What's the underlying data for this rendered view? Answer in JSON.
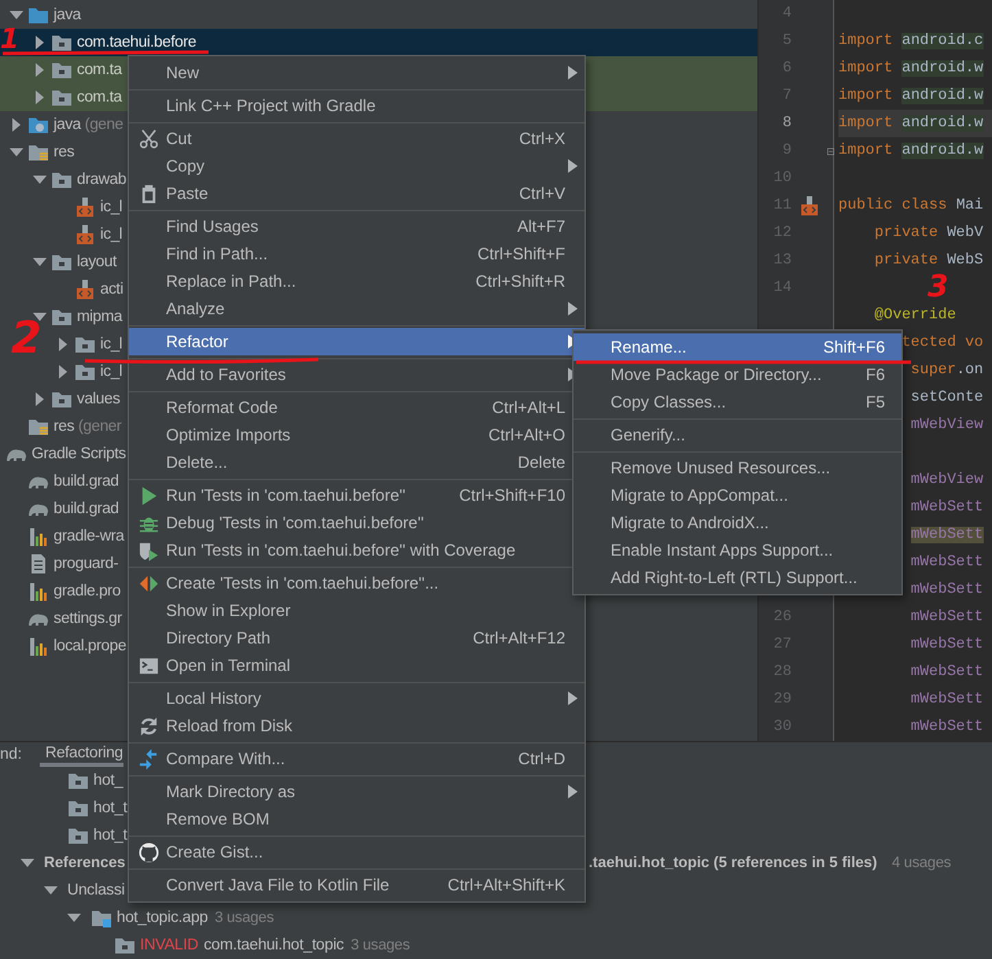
{
  "project_tree": [
    {
      "label": "java",
      "kind": "source-folder",
      "expanded": true,
      "selected": false,
      "highlighted": false,
      "children": [
        {
          "label": "com.taehui.before",
          "kind": "package",
          "expanded": false,
          "selected": true,
          "highlighted": false
        },
        {
          "label": "com.ta",
          "kind": "package",
          "expanded": false,
          "selected": false,
          "highlighted": true
        },
        {
          "label": "com.ta",
          "kind": "package",
          "expanded": false,
          "selected": false,
          "highlighted": true
        }
      ]
    },
    {
      "label": "java",
      "note": " (gene",
      "kind": "generated-folder",
      "expanded": false,
      "selected": false,
      "highlighted": false
    },
    {
      "label": "res",
      "kind": "resource-folder",
      "expanded": true,
      "selected": false,
      "highlighted": false,
      "children": [
        {
          "label": "drawab",
          "kind": "package",
          "expanded": true,
          "selected": false,
          "highlighted": false,
          "children": [
            {
              "label": "ic_l",
              "kind": "xml",
              "selected": false,
              "highlighted": false
            },
            {
              "label": "ic_l",
              "kind": "xml",
              "selected": false,
              "highlighted": false
            }
          ]
        },
        {
          "label": "layout",
          "kind": "package",
          "expanded": true,
          "selected": false,
          "highlighted": false,
          "children": [
            {
              "label": "acti",
              "kind": "xml",
              "selected": false,
              "highlighted": false
            }
          ]
        },
        {
          "label": "mipma",
          "kind": "package",
          "expanded": true,
          "selected": false,
          "highlighted": false,
          "children": [
            {
              "label": "ic_l",
              "kind": "package",
              "expanded": false,
              "selected": false,
              "highlighted": false
            },
            {
              "label": "ic_l",
              "kind": "package",
              "expanded": false,
              "selected": false,
              "highlighted": false
            }
          ]
        },
        {
          "label": "values",
          "kind": "package",
          "expanded": false,
          "selected": false,
          "highlighted": false
        }
      ]
    },
    {
      "label": "res",
      "note": " (gener",
      "kind": "resource-folder",
      "selected": false,
      "highlighted": false
    },
    {
      "label": "Gradle Scripts",
      "kind": "gradle-group",
      "selected": false,
      "highlighted": false,
      "children": [
        {
          "label": "build.grad",
          "kind": "gradle",
          "selected": false,
          "highlighted": false
        },
        {
          "label": "build.grad",
          "kind": "gradle",
          "selected": false,
          "highlighted": false
        },
        {
          "label": "gradle-wra",
          "kind": "properties",
          "selected": false,
          "highlighted": false
        },
        {
          "label": "proguard-",
          "kind": "text",
          "selected": false,
          "highlighted": false
        },
        {
          "label": "gradle.pro",
          "kind": "properties",
          "selected": false,
          "highlighted": false
        },
        {
          "label": "settings.gr",
          "kind": "gradle",
          "selected": false,
          "highlighted": false
        },
        {
          "label": "local.prope",
          "kind": "properties",
          "selected": false,
          "highlighted": false
        }
      ]
    }
  ],
  "editor": {
    "lines": [
      {
        "number": "4",
        "current": false
      },
      {
        "number": "5",
        "current": false,
        "tokens": [
          {
            "text": "import ",
            "kind": "keyword"
          },
          {
            "text": "android.c",
            "kind": "import-path"
          }
        ]
      },
      {
        "number": "6",
        "current": false,
        "tokens": [
          {
            "text": "import ",
            "kind": "keyword"
          },
          {
            "text": "android.w",
            "kind": "import-path"
          }
        ]
      },
      {
        "number": "7",
        "current": false,
        "tokens": [
          {
            "text": "import ",
            "kind": "keyword"
          },
          {
            "text": "android.w",
            "kind": "import-path"
          }
        ]
      },
      {
        "number": "8",
        "current": true,
        "tokens": [
          {
            "text": "import ",
            "kind": "keyword"
          },
          {
            "text": "android.w",
            "kind": "import-path"
          }
        ]
      },
      {
        "number": "9",
        "current": false,
        "kind": "fold",
        "tokens": [
          {
            "text": "import ",
            "kind": "keyword"
          },
          {
            "text": "android.w",
            "kind": "import-path"
          }
        ]
      },
      {
        "number": "10",
        "current": false
      },
      {
        "number": "11",
        "current": false,
        "kind": "layout-file",
        "tokens": [
          {
            "text": "public class ",
            "kind": "keyword"
          },
          {
            "text": "Mai",
            "kind": "plain"
          }
        ]
      },
      {
        "number": "12",
        "current": false,
        "tokens": [
          {
            "text": "    private ",
            "kind": "keyword"
          },
          {
            "text": "WebV",
            "kind": "plain"
          }
        ]
      },
      {
        "number": "13",
        "current": false,
        "tokens": [
          {
            "text": "    private ",
            "kind": "keyword"
          },
          {
            "text": "WebS",
            "kind": "plain"
          }
        ]
      },
      {
        "number": "14",
        "current": false
      },
      {
        "current": false,
        "tokens": [
          {
            "text": "    @Override",
            "kind": "annotation"
          }
        ]
      },
      {
        "current": false,
        "tokens": [
          {
            "text": "       tected vo",
            "kind": "keyword"
          }
        ]
      },
      {
        "current": false,
        "tokens": [
          {
            "text": "        super",
            "kind": "keyword"
          },
          {
            "text": ".on",
            "kind": "plain"
          }
        ]
      },
      {
        "current": false,
        "tokens": [
          {
            "text": "        setConte",
            "kind": "plain"
          }
        ]
      },
      {
        "current": false,
        "tokens": [
          {
            "text": "        mWebView",
            "kind": "field"
          }
        ]
      },
      {
        "current": false
      },
      {
        "current": false,
        "tokens": [
          {
            "text": "        mWebView",
            "kind": "field"
          }
        ]
      },
      {
        "current": false,
        "tokens": [
          {
            "text": "        mWebSett",
            "kind": "field"
          }
        ]
      },
      {
        "current": false,
        "tokens": [
          {
            "text": "        mWebSett",
            "kind": "field-usage"
          }
        ]
      },
      {
        "current": false,
        "tokens": [
          {
            "text": "        mWebSett",
            "kind": "field"
          }
        ]
      },
      {
        "current": false,
        "tokens": [
          {
            "text": "        mWebSett",
            "kind": "field"
          }
        ]
      },
      {
        "number": "26",
        "current": false,
        "tokens": [
          {
            "text": "        mWebSett",
            "kind": "field"
          }
        ]
      },
      {
        "number": "27",
        "current": false,
        "tokens": [
          {
            "text": "        mWebSett",
            "kind": "field"
          }
        ]
      },
      {
        "number": "28",
        "current": false,
        "tokens": [
          {
            "text": "        mWebSett",
            "kind": "field"
          }
        ]
      },
      {
        "number": "29",
        "current": false,
        "tokens": [
          {
            "text": "        mWebSett",
            "kind": "field"
          }
        ]
      },
      {
        "number": "30",
        "current": false,
        "tokens": [
          {
            "text": "        mWebSett",
            "kind": "field"
          }
        ]
      }
    ]
  },
  "find_panel": {
    "label": "nd:",
    "tabs": [
      {
        "label": "Refactoring",
        "selected": true
      }
    ],
    "upper_rows": [
      {
        "label": "hot_",
        "kind": "package"
      },
      {
        "label": "hot_t",
        "kind": "package"
      },
      {
        "label": "hot_t",
        "kind": "package"
      }
    ],
    "results": [
      {
        "label": "References",
        "detail": ".taehui.hot_topic (5 references in 5 files)",
        "count": "4 usages",
        "expanded": true,
        "children": [
          {
            "label": "Unclassi",
            "expanded": true,
            "children": [
              {
                "label": "hot_topic.app",
                "kind": "module",
                "count": "3 usages",
                "expanded": true,
                "children": [
                  {
                    "status": "INVALID",
                    "label": "com.taehui.hot_topic",
                    "kind": "package",
                    "count": "3 usages"
                  }
                ]
              }
            ]
          }
        ]
      }
    ]
  },
  "menu": {
    "sections": [
      [
        {
          "label": "New",
          "has_submenu": true,
          "selected": false
        }
      ],
      [
        {
          "label": "Link C++ Project with Gradle",
          "has_submenu": false,
          "selected": false
        }
      ],
      [
        {
          "label": "Cut",
          "kind": "scissors",
          "shortcut": "Ctrl+X",
          "has_submenu": false,
          "selected": false
        },
        {
          "label": "Copy",
          "has_submenu": true,
          "selected": false
        },
        {
          "label": "Paste",
          "kind": "clipboard",
          "shortcut": "Ctrl+V",
          "has_submenu": false,
          "selected": false
        }
      ],
      [
        {
          "label": "Find Usages",
          "shortcut": "Alt+F7",
          "has_submenu": false,
          "selected": false
        },
        {
          "label": "Find in Path...",
          "shortcut": "Ctrl+Shift+F",
          "has_submenu": false,
          "selected": false
        },
        {
          "label": "Replace in Path...",
          "shortcut": "Ctrl+Shift+R",
          "has_submenu": false,
          "selected": false
        },
        {
          "label": "Analyze",
          "has_submenu": true,
          "selected": false
        }
      ],
      [
        {
          "label": "Refactor",
          "has_submenu": true,
          "selected": true
        }
      ],
      [
        {
          "label": "Add to Favorites",
          "has_submenu": true,
          "selected": false
        }
      ],
      [
        {
          "label": "Reformat Code",
          "shortcut": "Ctrl+Alt+L",
          "has_submenu": false,
          "selected": false
        },
        {
          "label": "Optimize Imports",
          "shortcut": "Ctrl+Alt+O",
          "has_submenu": false,
          "selected": false
        },
        {
          "label": "Delete...",
          "shortcut": "Delete",
          "has_submenu": false,
          "selected": false
        }
      ],
      [
        {
          "label": "Run 'Tests in 'com.taehui.before''",
          "kind": "run",
          "shortcut": "Ctrl+Shift+F10",
          "has_submenu": false,
          "selected": false
        },
        {
          "label": "Debug 'Tests in 'com.taehui.before''",
          "kind": "debug",
          "has_submenu": false,
          "selected": false
        },
        {
          "label": "Run 'Tests in 'com.taehui.before'' with Coverage",
          "kind": "coverage",
          "has_submenu": false,
          "selected": false
        }
      ],
      [
        {
          "label": "Create 'Tests in 'com.taehui.before''...",
          "kind": "create-test",
          "has_submenu": false,
          "selected": false
        },
        {
          "label": "Show in Explorer",
          "has_submenu": false,
          "selected": false
        },
        {
          "label": "Directory Path",
          "shortcut": "Ctrl+Alt+F12",
          "has_submenu": false,
          "selected": false
        },
        {
          "label": "Open in Terminal",
          "kind": "terminal",
          "has_submenu": false,
          "selected": false
        }
      ],
      [
        {
          "label": "Local History",
          "has_submenu": true,
          "selected": false
        },
        {
          "label": "Reload from Disk",
          "kind": "reload",
          "has_submenu": false,
          "selected": false
        }
      ],
      [
        {
          "label": "Compare With...",
          "kind": "compare",
          "shortcut": "Ctrl+D",
          "has_submenu": false,
          "selected": false
        }
      ],
      [
        {
          "label": "Mark Directory as",
          "has_submenu": true,
          "selected": false
        },
        {
          "label": "Remove BOM",
          "has_submenu": false,
          "selected": false
        }
      ],
      [
        {
          "label": "Create Gist...",
          "kind": "gist",
          "has_submenu": false,
          "selected": false
        }
      ],
      [
        {
          "label": "Convert Java File to Kotlin File",
          "shortcut": "Ctrl+Alt+Shift+K",
          "has_submenu": false,
          "selected": false
        }
      ]
    ]
  },
  "submenu": {
    "sections": [
      [
        {
          "label": "Rename...",
          "shortcut": "Shift+F6",
          "selected": true
        },
        {
          "label": "Move Package or Directory...",
          "shortcut": "F6",
          "selected": false
        },
        {
          "label": "Copy Classes...",
          "shortcut": "F5",
          "selected": false
        }
      ],
      [
        {
          "label": "Generify...",
          "selected": false
        }
      ],
      [
        {
          "label": "Remove Unused Resources...",
          "selected": false
        },
        {
          "label": "Migrate to AppCompat...",
          "selected": false
        },
        {
          "label": "Migrate to AndroidX...",
          "selected": false
        },
        {
          "label": "Enable Instant Apps Support...",
          "selected": false
        },
        {
          "label": "Add Right-to-Left (RTL) Support...",
          "selected": false
        }
      ]
    ]
  },
  "annotations": [
    {
      "text": "1"
    },
    {
      "text": "2"
    },
    {
      "text": "3"
    }
  ]
}
